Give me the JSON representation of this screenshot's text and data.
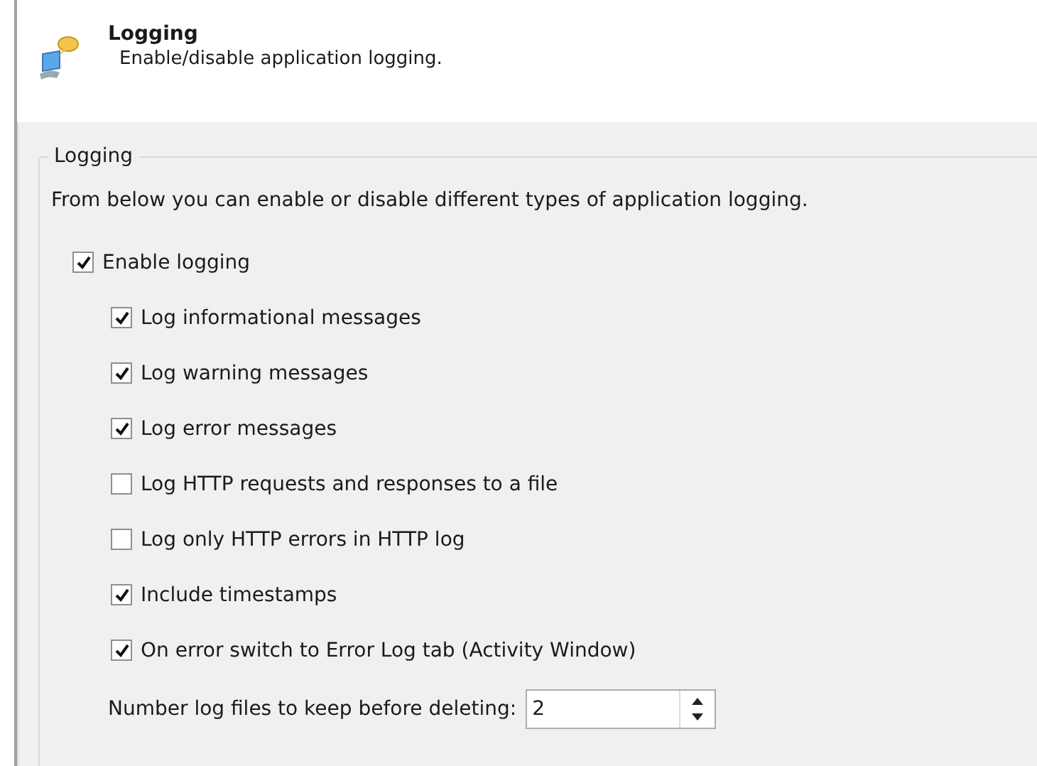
{
  "header": {
    "title": "Logging",
    "subtitle": "Enable/disable application logging."
  },
  "group": {
    "title": "Logging",
    "description": "From below you can enable or disable different types of application logging.",
    "options": [
      {
        "label": "Enable logging",
        "checked": true,
        "children": [
          {
            "label": "Log informational messages",
            "checked": true
          },
          {
            "label": "Log warning messages",
            "checked": true
          },
          {
            "label": "Log error messages",
            "checked": true
          },
          {
            "label": "Log HTTP requests and responses to a file",
            "checked": false
          },
          {
            "label": "Log only HTTP errors in HTTP log",
            "checked": false
          },
          {
            "label": "Include timestamps",
            "checked": true
          },
          {
            "label": "On error switch to Error Log tab (Activity Window)",
            "checked": true
          }
        ]
      }
    ]
  },
  "spinner": {
    "label": "Number log files to keep before deleting:",
    "value": "2"
  }
}
